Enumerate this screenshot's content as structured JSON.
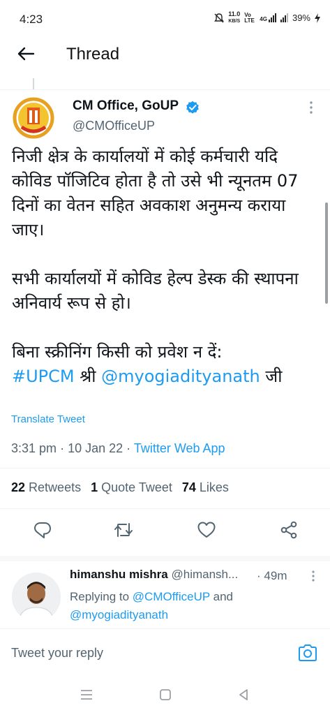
{
  "status": {
    "time": "4:23",
    "speed": "11.0",
    "speed_unit": "KB/S",
    "volte": "Vo LTE",
    "network": "4G",
    "battery": "39%"
  },
  "header": {
    "title": "Thread"
  },
  "tweet": {
    "author_name": "CM Office, GoUP",
    "author_handle": "@CMOfficeUP",
    "paragraphs": [
      "निजी क्षेत्र के कार्यालयों में कोई कर्मचारी यदि कोविड पॉजिटिव होता है तो उसे भी न्यूनतम 07 दिनों का वेतन सहित अवकाश अनुमन्य कराया जाए।",
      "सभी कार्यालयों में कोविड हेल्प डेस्क की स्थापना अनिवार्य रूप से हो।",
      "बिना स्क्रीनिंग किसी को प्रवेश न दें:"
    ],
    "hashtag": "#UPCM",
    "shri": "श्री",
    "mention": "@myogiadityanath",
    "ji": "जी",
    "translate_label": "Translate Tweet",
    "time": "3:31 pm",
    "date": "10 Jan 22",
    "source": "Twitter Web App",
    "retweets_count": "22",
    "retweets_label": "Retweets",
    "quote_count": "1",
    "quote_label": "Quote Tweet",
    "likes_count": "74",
    "likes_label": "Likes"
  },
  "reply": {
    "name": "himanshu mishra",
    "handle": "@himansh...",
    "dot": "·",
    "time": "49m",
    "replying_prefix": "Replying to",
    "to_user1": "@CMOfficeUP",
    "and": "and",
    "to_user2": "@myogiadityanath"
  },
  "replybox": {
    "placeholder": "Tweet your reply"
  },
  "colors": {
    "accent": "#1d9bf0",
    "text": "#0f1419",
    "muted": "#536471"
  },
  "icons": [
    "back-arrow-icon",
    "verified-badge-icon",
    "more-vertical-icon",
    "reply-icon",
    "retweet-icon",
    "like-icon",
    "share-icon",
    "camera-icon",
    "recents-icon",
    "home-icon",
    "back-nav-icon"
  ]
}
